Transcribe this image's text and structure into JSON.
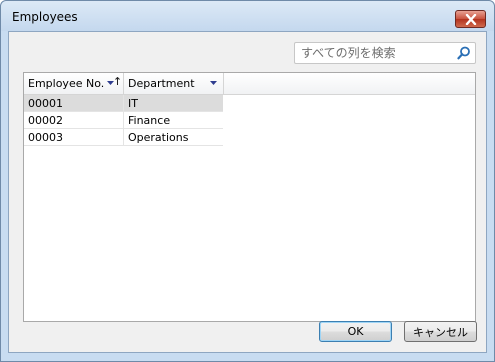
{
  "window": {
    "title": "Employees"
  },
  "search": {
    "placeholder": "すべての列を検索",
    "icon": "search-icon"
  },
  "grid": {
    "columns": [
      {
        "label": "Employee No.",
        "icons": [
          "filter-dropdown-icon",
          "sort-ascending-icon"
        ]
      },
      {
        "label": "Department",
        "icons": [
          "filter-dropdown-icon"
        ]
      }
    ],
    "rows": [
      {
        "employee_no": "00001",
        "department": "IT",
        "selected": true
      },
      {
        "employee_no": "00002",
        "department": "Finance",
        "selected": false
      },
      {
        "employee_no": "00003",
        "department": "Operations",
        "selected": false
      }
    ]
  },
  "buttons": {
    "ok": "OK",
    "cancel": "キャンセル"
  },
  "colors": {
    "accent": "#2f3d8f",
    "close_button": "#c8513d"
  }
}
